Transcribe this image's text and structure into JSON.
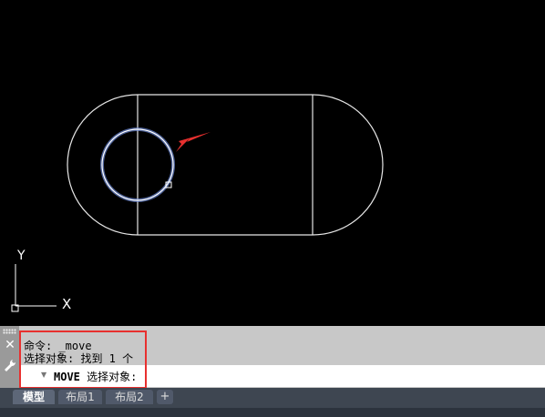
{
  "command_panel": {
    "history": [
      "命令: _move",
      "选择对象: 找到 1 个"
    ],
    "input_command": "MOVE",
    "input_prompt": "选择对象:"
  },
  "ucs": {
    "y_label": "Y",
    "x_label": "X"
  },
  "tabs": [
    {
      "label": "模型",
      "active": true
    },
    {
      "label": "布局1",
      "active": false
    },
    {
      "label": "布局2",
      "active": false
    }
  ],
  "tab_add_label": "+",
  "colors": {
    "background": "#000000",
    "drawing_lines": "#ffffff",
    "selection_highlight": "#6f8bd8",
    "annotation_arrow": "#e8302f",
    "highlight_box": "#e8302f"
  }
}
